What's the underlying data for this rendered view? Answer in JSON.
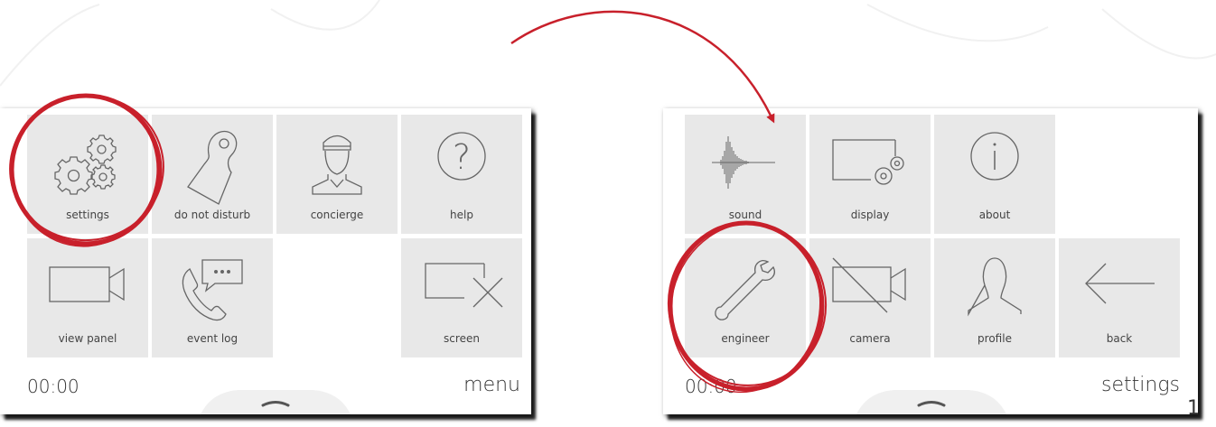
{
  "menu": {
    "tiles": [
      {
        "label": "settings",
        "icon": "gears-icon"
      },
      {
        "label": "do not disturb",
        "icon": "door-hanger-icon"
      },
      {
        "label": "concierge",
        "icon": "concierge-icon"
      },
      {
        "label": "help",
        "icon": "help-icon"
      },
      {
        "label": "view panel",
        "icon": "video-camera-icon"
      },
      {
        "label": "event log",
        "icon": "phone-message-icon"
      },
      {
        "label": "screen",
        "icon": "screen-off-icon"
      }
    ],
    "clock": "00:00",
    "title": "menu"
  },
  "settings": {
    "tiles": [
      {
        "label": "sound",
        "icon": "sound-wave-icon"
      },
      {
        "label": "display",
        "icon": "display-settings-icon"
      },
      {
        "label": "about",
        "icon": "info-icon"
      },
      {
        "label": "engineer",
        "icon": "wrench-icon"
      },
      {
        "label": "camera",
        "icon": "camera-off-icon"
      },
      {
        "label": "profile",
        "icon": "profile-icon"
      },
      {
        "label": "back",
        "icon": "back-arrow-icon"
      }
    ],
    "clock": "00:00",
    "title": "settings"
  },
  "page_number": "1",
  "colors": {
    "tile": "#e8e8e8",
    "highlight": "#c8202b",
    "icon_stroke": "#666666",
    "text": "#333333"
  }
}
